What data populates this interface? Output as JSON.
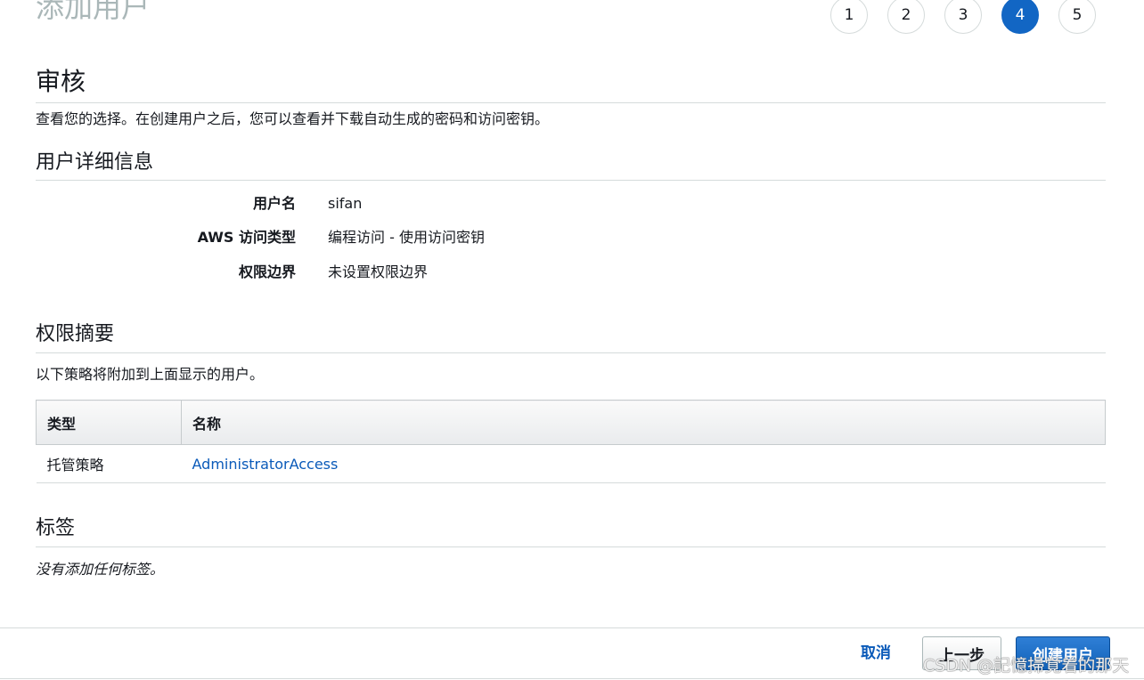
{
  "header": {
    "title": "添加用户",
    "steps": [
      "1",
      "2",
      "3",
      "4",
      "5"
    ],
    "active_step": "4"
  },
  "review": {
    "heading": "审核",
    "description": "查看您的选择。在创建用户之后，您可以查看并下载自动生成的密码和访问密钥。"
  },
  "user_details": {
    "heading": "用户详细信息",
    "rows": [
      {
        "label": "用户名",
        "value": "sifan"
      },
      {
        "label": "AWS 访问类型",
        "value": "编程访问 - 使用访问密钥"
      },
      {
        "label": "权限边界",
        "value": "未设置权限边界"
      }
    ]
  },
  "permissions": {
    "heading": "权限摘要",
    "description": "以下策略将附加到上面显示的用户。",
    "columns": [
      "类型",
      "名称"
    ],
    "rows": [
      {
        "type": "托管策略",
        "name": "AdministratorAccess"
      }
    ]
  },
  "tags": {
    "heading": "标签",
    "empty_text": "没有添加任何标签。"
  },
  "footer": {
    "cancel_label": "取消",
    "previous_label": "上一步",
    "create_label": "创建用户"
  },
  "watermark": "CSDN @記憶掃覚着的那天",
  "colors": {
    "accent": "#1266c4",
    "link": "#0a5ab9",
    "title_muted": "#aab7b8"
  }
}
